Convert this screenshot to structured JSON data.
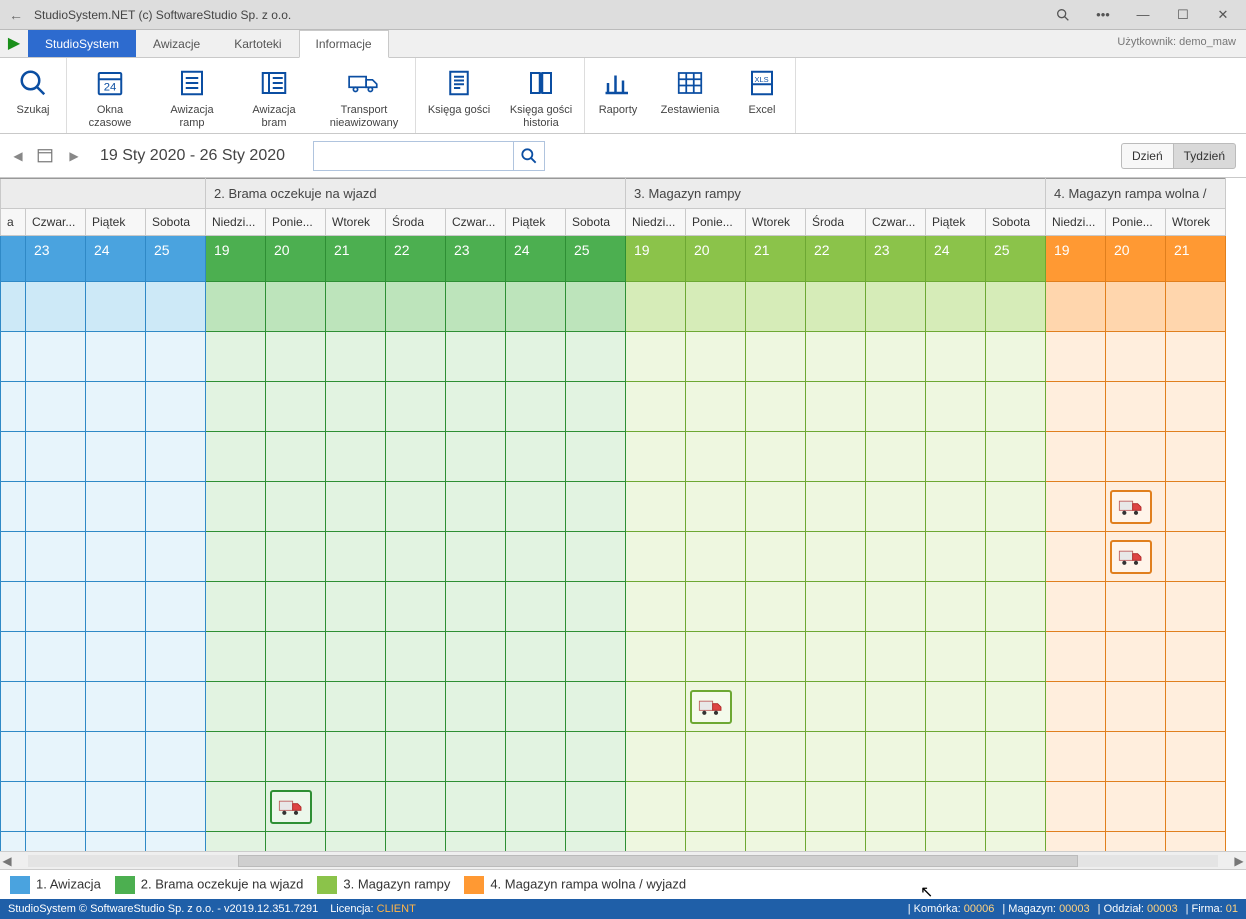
{
  "window": {
    "title": "StudioSystem.NET (c) SoftwareStudio Sp. z o.o."
  },
  "tabs": {
    "primary": "StudioSystem",
    "items": [
      "Awizacje",
      "Kartoteki",
      "Informacje"
    ],
    "activeIndex": 2
  },
  "user_label": "Użytkownik: demo_maw",
  "ribbon": {
    "search": "Szukaj",
    "okna": "Okna czasowe",
    "ramp": "Awizacja ramp",
    "bram": "Awizacja bram",
    "transport": "Transport\nnieawizowany",
    "gosci": "Księga gości",
    "gosci_hist": "Księga gości\nhistoria",
    "raporty": "Raporty",
    "zestawienia": "Zestawienia",
    "excel": "Excel"
  },
  "datebar": {
    "range": "19 Sty 2020 - 26 Sty 2020",
    "search_placeholder": ""
  },
  "view": {
    "day": "Dzień",
    "week": "Tydzień"
  },
  "sections": {
    "s2": "2. Brama oczekuje na wjazd",
    "s3": "3. Magazyn rampy",
    "s4": "4. Magazyn rampa wolna / "
  },
  "days_left": [
    {
      "name": "a",
      "num": ""
    },
    {
      "name": "Czwar...",
      "num": "23"
    },
    {
      "name": "Piątek",
      "num": "24"
    },
    {
      "name": "Sobota",
      "num": "25"
    }
  ],
  "days_full": [
    {
      "name": "Niedzi...",
      "num": "19"
    },
    {
      "name": "Ponie...",
      "num": "20"
    },
    {
      "name": "Wtorek",
      "num": "21"
    },
    {
      "name": "Środa",
      "num": "22"
    },
    {
      "name": "Czwar...",
      "num": "23"
    },
    {
      "name": "Piątek",
      "num": "24"
    },
    {
      "name": "Sobota",
      "num": "25"
    }
  ],
  "days_right": [
    {
      "name": "Niedzi...",
      "num": "19"
    },
    {
      "name": "Ponie...",
      "num": "20"
    },
    {
      "name": "Wtorek",
      "num": "21"
    }
  ],
  "legend": {
    "l1": "1. Awizacja",
    "l2": "2. Brama oczekuje na wjazd",
    "l3": "3. Magazyn rampy",
    "l4": "4. Magazyn rampa wolna / wyjazd"
  },
  "status": {
    "left": "StudioSystem © SoftwareStudio Sp. z o.o. - v2019.12.351.7291",
    "lic_label": "Licencja:",
    "lic_val": "CLIENT",
    "komorka_l": "Komórka:",
    "komorka_v": "00006",
    "magazyn_l": "Magazyn:",
    "magazyn_v": "00003",
    "oddzial_l": "Oddział:",
    "oddzial_v": "00003",
    "firma_l": "Firma:",
    "firma_v": "01"
  },
  "events": [
    {
      "section": 2,
      "dayIndex": 1,
      "row": 10
    },
    {
      "section": 3,
      "dayIndex": 1,
      "row": 8
    },
    {
      "section": 4,
      "dayIndex": 1,
      "row": 4
    },
    {
      "section": 4,
      "dayIndex": 1,
      "row": 5
    }
  ]
}
